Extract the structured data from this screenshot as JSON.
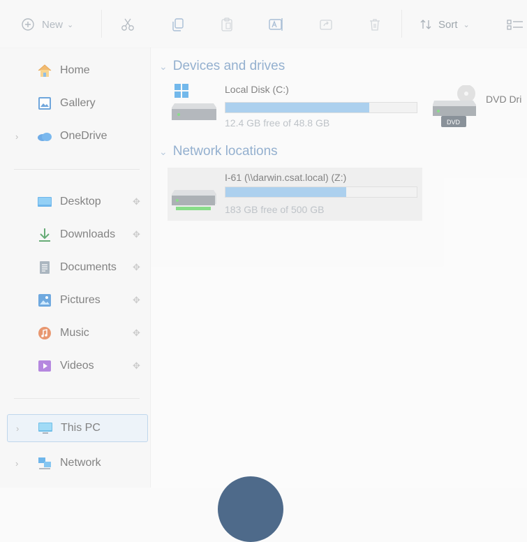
{
  "toolbar": {
    "new_label": "New",
    "sort_label": "Sort"
  },
  "sidebar": {
    "items": [
      {
        "label": "Home"
      },
      {
        "label": "Gallery"
      },
      {
        "label": "OneDrive"
      },
      {
        "label": "Desktop"
      },
      {
        "label": "Downloads"
      },
      {
        "label": "Documents"
      },
      {
        "label": "Pictures"
      },
      {
        "label": "Music"
      },
      {
        "label": "Videos"
      },
      {
        "label": "This PC"
      },
      {
        "label": "Network"
      }
    ]
  },
  "content": {
    "devices_header": "Devices and drives",
    "network_header": "Network locations",
    "local_disk": {
      "name": "Local Disk (C:)",
      "free_text": "12.4 GB free of 48.8 GB",
      "used_fraction": 0.75
    },
    "dvd": {
      "name": "DVD Dri",
      "badge": "DVD"
    },
    "network_drive": {
      "name": "I-61 (\\\\darwin.csat.local) (Z:)",
      "free_text": "183 GB free of 500 GB",
      "used_fraction": 0.63
    }
  },
  "colors": {
    "accent": "#6d94bf",
    "bar_fill": "#8fc0ea",
    "selected_bg": "#e9f1f9"
  }
}
